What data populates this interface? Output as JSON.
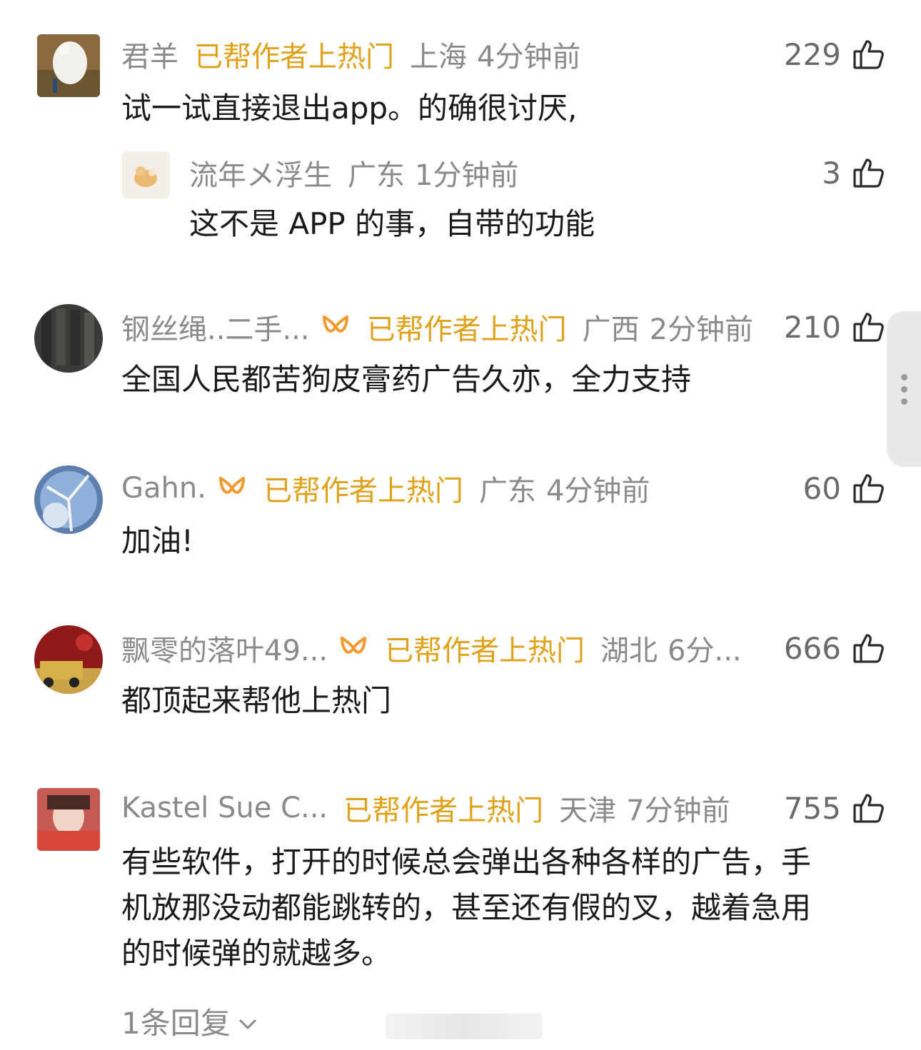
{
  "comments": [
    {
      "name": "君羊",
      "hot_label": "已帮作者上热门",
      "location": "上海",
      "time": "4分钟前",
      "likes": "229",
      "text": "试一试直接退出app。的确很讨厌,",
      "reply": {
        "name": "流年メ浮生",
        "location": "广东",
        "time": "1分钟前",
        "likes": "3",
        "text": "这不是 APP 的事，自带的功能"
      }
    },
    {
      "name": "钢丝绳..二手...",
      "hot_label": "已帮作者上热门",
      "location": "广西",
      "time": "2分钟前",
      "likes": "210",
      "text": "全国人民都苦狗皮膏药广告久亦，全力支持"
    },
    {
      "name": "Gahn.",
      "hot_label": "已帮作者上热门",
      "location": "广东",
      "time": "4分钟前",
      "likes": "60",
      "text": "加油!"
    },
    {
      "name": "飘零的落叶49...",
      "hot_label": "已帮作者上热门",
      "location": "湖北",
      "time": "6分...",
      "likes": "666",
      "text": "都顶起来帮他上热门"
    },
    {
      "name": "Kastel Sue C...",
      "hot_label": "已帮作者上热门",
      "location": "天津",
      "time": "7分钟前",
      "likes": "755",
      "text_lines": [
        "有些软件，打开的时候总会弹出各种各样的广告，手",
        "机放那没动都能跳转的，甚至还有假的叉，越着急用",
        "的时候弹的就越多。"
      ],
      "replies_label": "1条回复"
    }
  ],
  "colors": {
    "hot": "#e0a21a",
    "meta": "#8a8a8a",
    "text": "#1a1a1a"
  }
}
